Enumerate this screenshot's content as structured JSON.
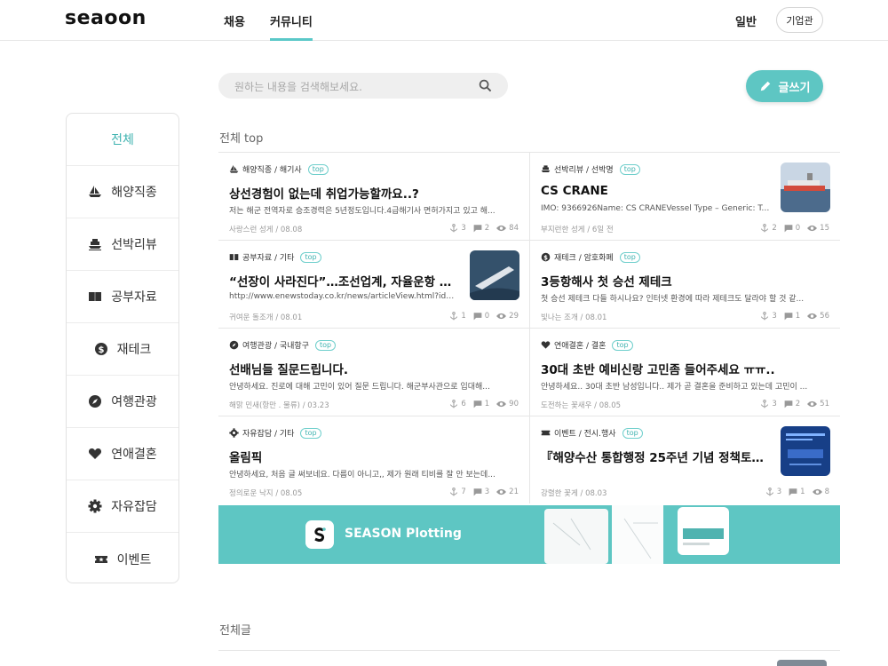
{
  "header": {
    "logo": "seaoon",
    "tabs": [
      "채용",
      "커뮤니티"
    ],
    "active_tab": "커뮤니티",
    "user_mode": "일반",
    "biz_button": "기업관"
  },
  "search": {
    "placeholder": "원하는 내용을 검색해보세요."
  },
  "write_button": "글쓰기",
  "sidebar": {
    "items": [
      {
        "label": "전체",
        "icon": "none"
      },
      {
        "label": "해양직종",
        "icon": "ship-icon"
      },
      {
        "label": "선박리뷰",
        "icon": "ferry-icon"
      },
      {
        "label": "공부자료",
        "icon": "book-icon"
      },
      {
        "label": "재테크",
        "icon": "dollar-icon"
      },
      {
        "label": "여행관광",
        "icon": "compass-icon"
      },
      {
        "label": "연애결혼",
        "icon": "heart-icon"
      },
      {
        "label": "자유잡담",
        "icon": "gear-icon"
      },
      {
        "label": "이벤트",
        "icon": "ticket-icon"
      }
    ]
  },
  "sections": {
    "top_title": "전체 top",
    "all_title": "전체글"
  },
  "badge": "top",
  "posts": [
    {
      "category": "해양직종 / 해기사",
      "title": "상선경험이 없는데 취업가능할까요..?",
      "excerpt": "저는 해군 전역자로 승조경력은 5년정도입니다.4급해기사 면허가지고 있고 해...",
      "meta": "사랑스런 성게 / 08.08",
      "likes": "3",
      "comments": "2",
      "views": "84"
    },
    {
      "category": "선박리뷰 / 선박명",
      "title": "CS CRANE",
      "excerpt": "IMO: 9366926Name: CS CRANEVessel Type – Generic: Ta...",
      "meta": "부지런한 성게 / 6일 전",
      "likes": "2",
      "comments": "0",
      "views": "15"
    },
    {
      "category": "공부자료 / 기타",
      "title": "“선장이 사라진다”…조선업계, 자율운항 선...",
      "excerpt": "http://www.enewstoday.co.kr/news/articleView.html?idx...",
      "meta": "귀여운 돌조개 / 08.01",
      "likes": "1",
      "comments": "0",
      "views": "29"
    },
    {
      "category": "재테크 / 암호화폐",
      "title": "3등항해사 첫 승선 제테크",
      "excerpt": "첫 승선 제테크 다들 하시나요? 인터넷 환경에 따라 제테크도 달라야 할 것 같...",
      "meta": "빛나는 조개 / 08.01",
      "likes": "3",
      "comments": "1",
      "views": "56"
    },
    {
      "category": "여행관광 / 국내항구",
      "title": "선배님들 질문드립니다.",
      "excerpt": "안녕하세요. 진로에 대해 고민이 있어 질문 드립니다. 해군부사관으로 입대해...",
      "meta": "해맑 민새(항만 . 물류) / 03.23",
      "likes": "6",
      "comments": "1",
      "views": "90"
    },
    {
      "category": "연애결혼 / 결혼",
      "title": "30대 초반 예비신랑 고민좀 들어주세요 ㅠㅠ..",
      "excerpt": "안녕하세요.. 30대 초반 남성입니다.. 제가 곧 결혼을 준비하고 있는데 고민이 ...",
      "meta": "도전하는 꽃새우 / 08.05",
      "likes": "3",
      "comments": "2",
      "views": "51"
    },
    {
      "category": "자유잡담 / 기타",
      "title": "올림픽",
      "excerpt": "안녕하세요, 처음 글 써보네요. 다름이 아니고,, 제가 원래 티비를 잘 안 보는데...",
      "meta": "정의로운 낙지 / 08.05",
      "likes": "7",
      "comments": "3",
      "views": "21"
    },
    {
      "category": "이벤트 / 전시.행사",
      "title": "『해양수산 통합행정 25주년 기념 정책토론...",
      "excerpt": "",
      "meta": "강렬한 꽃게 / 08.03",
      "likes": "3",
      "comments": "1",
      "views": "8"
    }
  ],
  "banner": {
    "text": "SEASON Plotting"
  },
  "colors": {
    "accent": "#5ec6c3",
    "accent_text": "#3fb3b0"
  }
}
